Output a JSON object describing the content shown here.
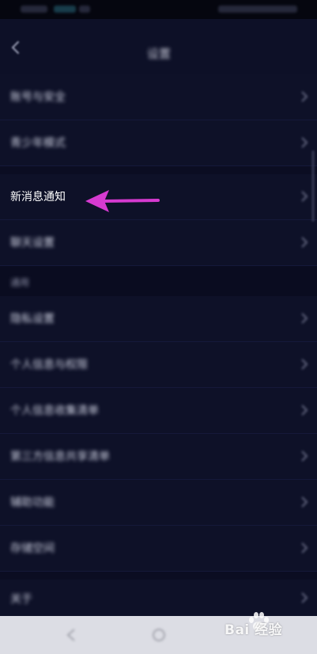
{
  "header": {
    "title": "设置"
  },
  "rows": [
    {
      "label": "账号与安全"
    },
    {
      "label": "青少年模式"
    },
    {
      "label": "新消息通知"
    },
    {
      "label": "聊天设置"
    }
  ],
  "section_header": {
    "label": "通用"
  },
  "rows2": [
    {
      "label": "隐私设置"
    },
    {
      "label": "个人信息与权限"
    },
    {
      "label": "个人信息收集清单"
    },
    {
      "label": "第三方信息共享清单"
    },
    {
      "label": "辅助功能"
    },
    {
      "label": "存储空间"
    },
    {
      "label": "关于"
    }
  ],
  "watermark": {
    "text": "Bai 经验"
  },
  "colors": {
    "background": "#0b0d22",
    "arrow": "#d63ad0",
    "nav_bar": "#dcdde4"
  },
  "icons": [
    "back-arrow-icon",
    "chevron-right-icon",
    "pointer-arrow-icon",
    "paw-icon"
  ]
}
